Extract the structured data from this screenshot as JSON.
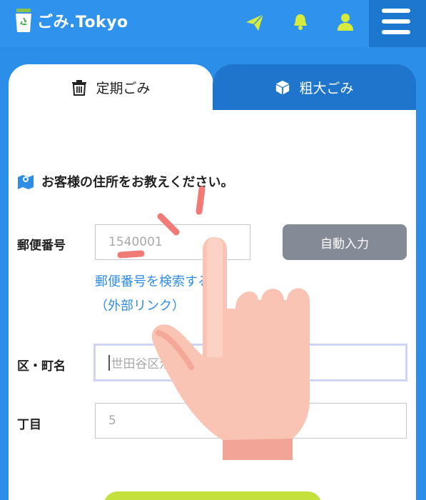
{
  "header": {
    "logo_text": "ごみ.Tokyo",
    "icons": [
      "paper-plane-icon",
      "bell-icon",
      "user-icon",
      "hamburger-menu-icon"
    ]
  },
  "tabs": [
    {
      "label": "定期ごみ",
      "icon": "trash-icon",
      "active": true
    },
    {
      "label": "粗大ごみ",
      "icon": "box-icon",
      "active": false
    }
  ],
  "form": {
    "prompt": "お客様の住所をお教えください。",
    "postal": {
      "label": "郵便番号",
      "placeholder": "1540001",
      "button": "自動入力",
      "link_line1": "郵便番号を検索する",
      "link_line2": "（外部リンク）"
    },
    "town": {
      "label": "区・町名",
      "placeholder": "世田谷区池尻"
    },
    "chome": {
      "label": "丁目",
      "placeholder": "5"
    }
  },
  "colors": {
    "header": "#2f93ee",
    "tab_inactive": "#1f75cc",
    "accent_yellow": "#d6ec3c",
    "button_gray": "#848a96",
    "link": "#2f8de4"
  }
}
